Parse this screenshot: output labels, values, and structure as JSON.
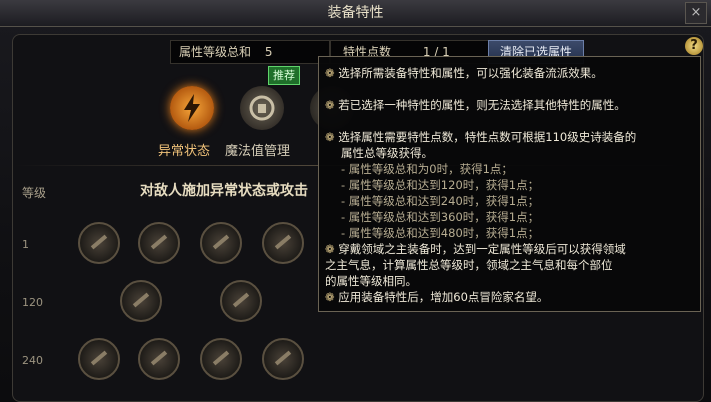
{
  "window": {
    "title": "装备特性",
    "close": "×"
  },
  "header": {
    "attr_total_label": "属性等级总和",
    "attr_total_value": "5",
    "points_label": "特性点数",
    "points_value": "1 / 1",
    "clear_button": "清除已选属性",
    "help": "?"
  },
  "categories": [
    {
      "label": "异常状态",
      "icon": "abnormal-status-icon"
    },
    {
      "label": "魔法值管理",
      "icon": "mana-management-icon"
    },
    {
      "label": "",
      "icon": "third-category-icon"
    }
  ],
  "recommend_badge": "推荐",
  "grid": {
    "level_header": "等级",
    "row_title": "对敌人施加异常状态或攻击",
    "levels": [
      "1",
      "120",
      "240"
    ]
  },
  "tooltip": {
    "items": [
      {
        "text": "选择所需装备特性和属性，可以强化装备流派效果。"
      },
      {
        "text": "若已选择一种特性的属性，则无法选择其他特性的属性。"
      },
      {
        "text": "选择属性需要特性点数，特性点数可根据110级史诗装备的",
        "cont": "属性总等级获得。",
        "subs": [
          "- 属性等级总和为0时，获得1点；",
          "- 属性等级总和达到120时，获得1点；",
          "- 属性等级总和达到240时，获得1点；",
          "- 属性等级总和达到360时，获得1点；",
          "- 属性等级总和达到480时，获得1点；"
        ]
      },
      {
        "text": "穿戴领域之主装备时，达到一定属性等级后可以获得领域",
        "cont1": "之主气息，计算属性总等级时，领域之主气息和每个部位",
        "cont2": "的属性等级相同。"
      },
      {
        "text": "应用装备特性后，增加60点冒险家名望。"
      }
    ]
  }
}
